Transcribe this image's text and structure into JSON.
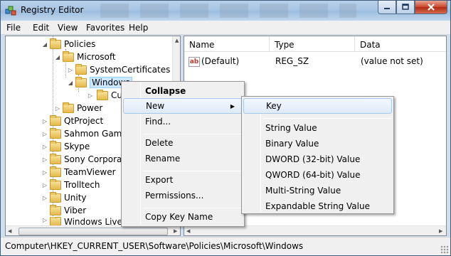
{
  "window": {
    "title": "Registry Editor",
    "icon": "registry-cubes-icon"
  },
  "menubar": [
    "File",
    "Edit",
    "View",
    "Favorites",
    "Help"
  ],
  "tree": {
    "items": [
      {
        "label": "Policies",
        "expanded": true
      },
      {
        "label": "Microsoft",
        "expanded": true
      },
      {
        "label": "SystemCertificates",
        "expanded": false
      },
      {
        "label": "Windows",
        "expanded": true,
        "selected": true
      },
      {
        "label": "Cu",
        "expanded": false
      },
      {
        "label": "Power",
        "expanded": false
      },
      {
        "label": "QtProject",
        "expanded": false
      },
      {
        "label": "Sahmon Gam",
        "expanded": false
      },
      {
        "label": "Skype",
        "expanded": false
      },
      {
        "label": "Sony Corporat",
        "expanded": false
      },
      {
        "label": "TeamViewer",
        "expanded": false
      },
      {
        "label": "Trolltech",
        "expanded": false
      },
      {
        "label": "Unity",
        "expanded": false
      },
      {
        "label": "Viber",
        "expanded": false
      },
      {
        "label": "Windows Live",
        "expanded": false
      }
    ]
  },
  "list": {
    "columns": [
      "Name",
      "Type",
      "Data"
    ],
    "rows": [
      {
        "name": "(Default)",
        "type": "REG_SZ",
        "data": "(value not set)"
      }
    ]
  },
  "context_menu": {
    "items": [
      "Collapse",
      "New",
      "Find...",
      "Delete",
      "Rename",
      "Export",
      "Permissions...",
      "Copy Key Name"
    ]
  },
  "submenu": {
    "items": [
      "Key",
      "String Value",
      "Binary Value",
      "DWORD (32-bit) Value",
      "QWORD (64-bit) Value",
      "Multi-String Value",
      "Expandable String Value"
    ]
  },
  "status": {
    "path": "Computer\\HKEY_CURRENT_USER\\Software\\Policies\\Microsoft\\Windows"
  },
  "colors": {
    "highlight_border": "#a9c8ee",
    "selection": "#cce8ff",
    "folder": "#e5b94c"
  }
}
